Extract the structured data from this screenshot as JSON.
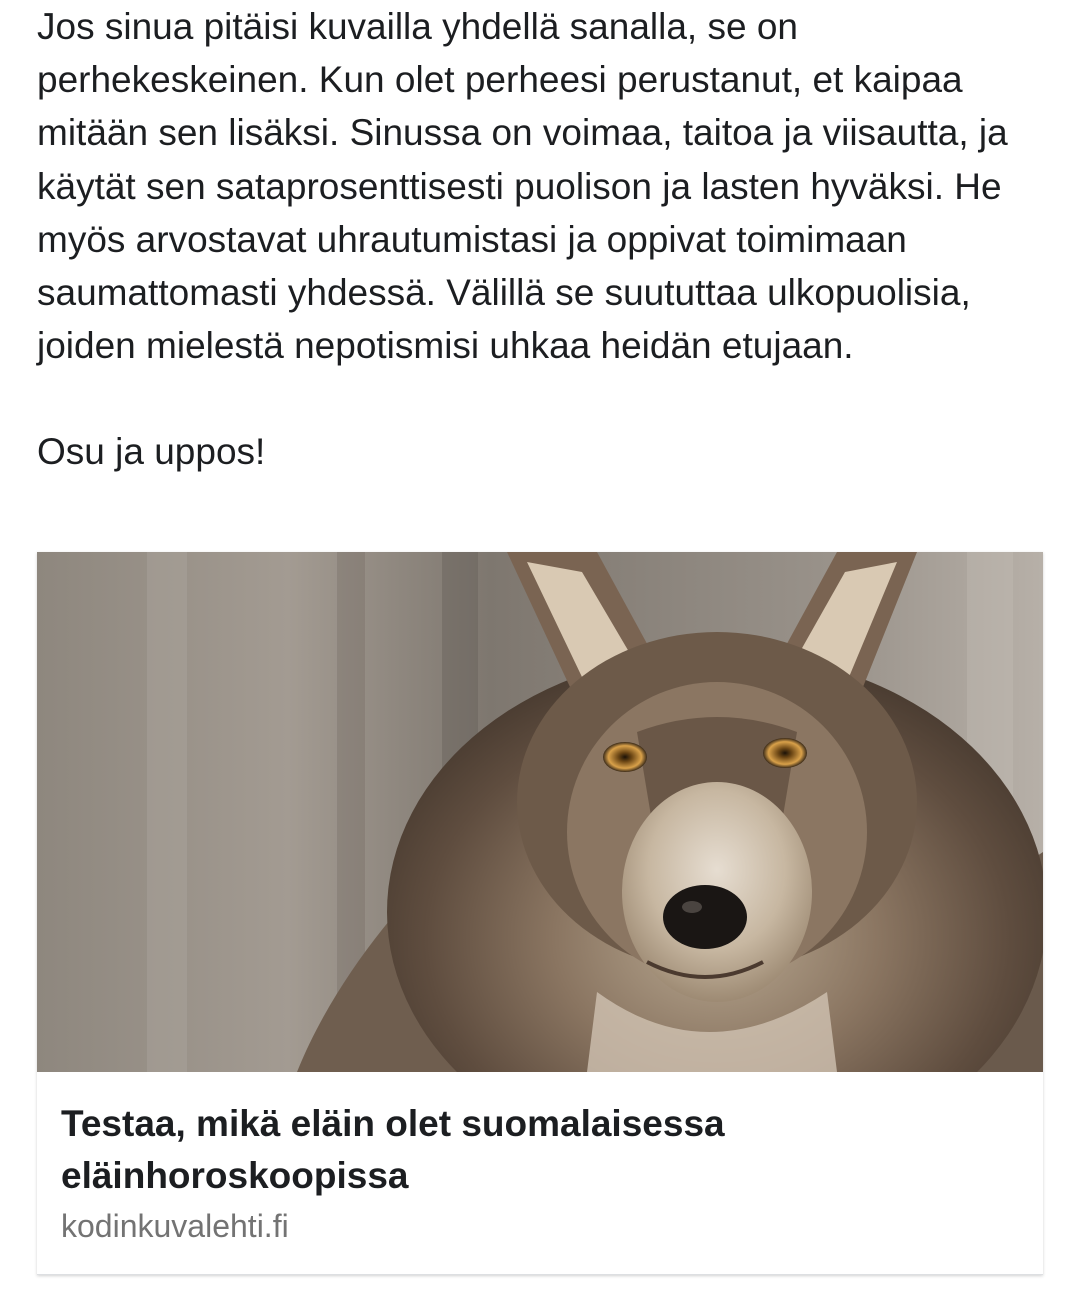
{
  "post": {
    "paragraph_1": "Jos sinua pitäisi kuvailla yhdellä sanalla, se on perhekeskeinen. Kun olet perheesi perustanut, et kaipaa mitään sen lisäksi. Sinussa on voimaa, taitoa ja viisautta, ja käytät sen sataprosenttisesti puolison ja lasten hyväksi. He myös arvostavat uhrautumistasi ja oppivat toimimaan saumattomasti yhdessä. Välillä se suututtaa ulkopuolisia, joiden mielestä nepotismisi uhkaa heidän etujaan.",
    "paragraph_2": "Osu ja uppos!"
  },
  "link_card": {
    "image_subject": "wolf",
    "title": "Testaa, mikä eläin olet suomalaisessa eläinhoroskoopissa",
    "domain": "kodinkuvalehti.fi"
  }
}
